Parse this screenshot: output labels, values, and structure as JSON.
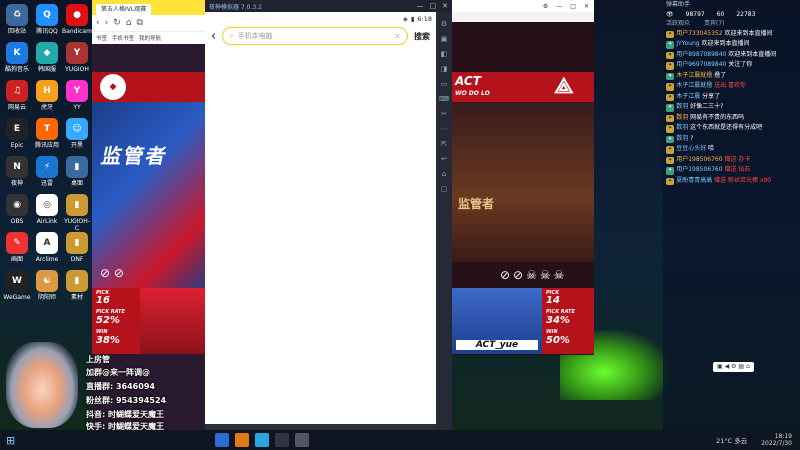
{
  "desktop": {
    "icons": [
      {
        "label": "回收站",
        "glyph": "♻",
        "color": "#3b6aa0"
      },
      {
        "label": "腾讯QQ",
        "glyph": "Q",
        "color": "#1e90ff"
      },
      {
        "label": "Bandicam",
        "glyph": "●",
        "color": "#d11"
      },
      {
        "label": "酷狗音乐",
        "glyph": "K",
        "color": "#1c7be0"
      },
      {
        "label": "韩国服",
        "glyph": "◆",
        "color": "#2aa"
      },
      {
        "label": "YUGIOH",
        "glyph": "Y",
        "color": "#a33"
      },
      {
        "label": "网易云",
        "glyph": "♫",
        "color": "#c22"
      },
      {
        "label": "虎牙",
        "glyph": "H",
        "color": "#f6a11b"
      },
      {
        "label": "YY",
        "glyph": "Y",
        "color": "#f3c"
      },
      {
        "label": "Epic",
        "glyph": "E",
        "color": "#222"
      },
      {
        "label": "腾讯应用",
        "glyph": "T",
        "color": "#f60"
      },
      {
        "label": "开黑",
        "glyph": "☺",
        "color": "#3af"
      },
      {
        "label": "夜神",
        "glyph": "N",
        "color": "#333"
      },
      {
        "label": "迅雷",
        "glyph": "⚡",
        "color": "#1976d2"
      },
      {
        "label": "桌面",
        "glyph": "▮",
        "color": "#3b6aa0"
      },
      {
        "label": "OBS",
        "glyph": "◉",
        "color": "#333"
      },
      {
        "label": "AirLink",
        "glyph": "◎",
        "color": "#fff"
      },
      {
        "label": "YUGIOH-C",
        "glyph": "▮",
        "color": "#c93"
      },
      {
        "label": "画图",
        "glyph": "✎",
        "color": "#e33"
      },
      {
        "label": "Arclime",
        "glyph": "A",
        "color": "#fff"
      },
      {
        "label": "DNF",
        "glyph": "▮",
        "color": "#c93"
      },
      {
        "label": "WeGame",
        "glyph": "W",
        "color": "#222"
      },
      {
        "label": "阴阳师",
        "glyph": "☯",
        "color": "#d94"
      },
      {
        "label": "素材",
        "glyph": "▮",
        "color": "#c93"
      }
    ]
  },
  "browser": {
    "tab_label": "第五人格IVL观赛",
    "fav_items": [
      "书签",
      "手机书签",
      "我的导航"
    ]
  },
  "game_left": {
    "banner_text": "监管者",
    "stats": [
      {
        "label": "PICK",
        "value": "16"
      },
      {
        "label": "PICK RATE",
        "value": "52%"
      },
      {
        "label": "WIN",
        "value": "38%"
      }
    ]
  },
  "emulator": {
    "title": "夜神模拟器 7.0.3.2",
    "window_controls": [
      "—",
      "□",
      "✕"
    ],
    "time": "6:18",
    "search_placeholder": "手机本电脑",
    "search_button": "搜索",
    "back_icon": "‹",
    "clear_icon": "✕",
    "side_icons": [
      "⚙",
      "▣",
      "◧",
      "◨",
      "▭",
      "⌨",
      "✂",
      "⋯",
      "⇱",
      "↩",
      "⌂",
      "▢"
    ]
  },
  "game_right": {
    "top_label": "ACT",
    "sub_label": "WO DO LO",
    "banner_text": "监管者",
    "player_name": "ACT_yue",
    "stats": [
      {
        "label": "PICK",
        "value": "14"
      },
      {
        "label": "PICK RATE",
        "value": "34%"
      },
      {
        "label": "WIN",
        "value": "50%"
      }
    ]
  },
  "chat": {
    "header": "弹幕助手",
    "stats": [
      "98797",
      "60",
      "22783"
    ],
    "tabs": [
      "活跃观众",
      "贵宾(7)"
    ],
    "messages": [
      {
        "name": "用户733045352",
        "text": "欢迎来到本直播间"
      },
      {
        "name": "JYYoung",
        "text": "欢迎来到本直播间"
      },
      {
        "name": "用户8987089840",
        "text": "欢迎来到本直播间"
      },
      {
        "name": "用户9697089840",
        "text": "关注了你"
      },
      {
        "name": "木子江晨就撸",
        "text": "撸了"
      },
      {
        "name": "木子江晨就撸",
        "text": "送出 喜欢你"
      },
      {
        "name": "木子江晨",
        "text": "分享了"
      },
      {
        "name": "数羽",
        "text": "好像二三十?"
      },
      {
        "name": "数羽",
        "text": "网易有不贵的东西吗"
      },
      {
        "name": "数羽",
        "text": "这个东西就是还得有分成吧"
      },
      {
        "name": "数羽",
        "text": "?"
      },
      {
        "name": "豆豆心头好",
        "text": "哈"
      },
      {
        "name": "用户198506760",
        "text": "赠送 办卡"
      },
      {
        "name": "用户198506760",
        "text": "赠送 钻石"
      },
      {
        "name": "夏盼青青高高",
        "text": "赠送 粉丝荧光棒 x90"
      }
    ]
  },
  "streamer": {
    "lines": [
      "上房管",
      "加群@来一阵调@",
      "直播群: 3646094",
      "粉丝群: 954394524",
      "抖音: 时蝴蝶爱天魔王",
      "快手: 时蝴蝶爱天魔王"
    ]
  },
  "taskbar": {
    "weather": "21°C 多云",
    "time": "18:19",
    "date": "2022/7/30"
  }
}
